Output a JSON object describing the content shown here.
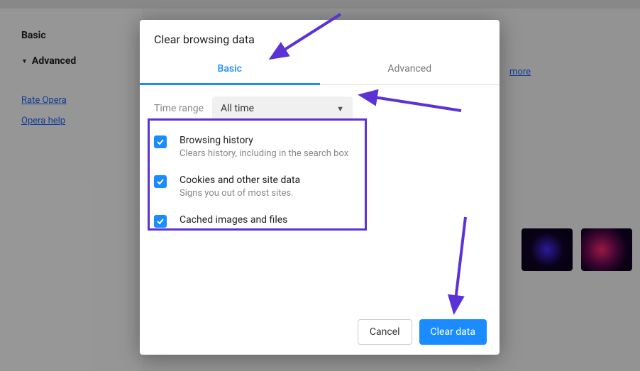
{
  "sidebar": {
    "basic": "Basic",
    "advanced": "Advanced",
    "rate": "Rate Opera",
    "help": "Opera help"
  },
  "learn_more": "more",
  "dialog": {
    "title": "Clear browsing data",
    "tabs": {
      "basic": "Basic",
      "advanced": "Advanced"
    },
    "time_range_label": "Time range",
    "time_range_value": "All time",
    "options": [
      {
        "title": "Browsing history",
        "subtitle": "Clears history, including in the search box"
      },
      {
        "title": "Cookies and other site data",
        "subtitle": "Signs you out of most sites."
      },
      {
        "title": "Cached images and files",
        "subtitle": ""
      }
    ],
    "cancel": "Cancel",
    "clear": "Clear data"
  }
}
